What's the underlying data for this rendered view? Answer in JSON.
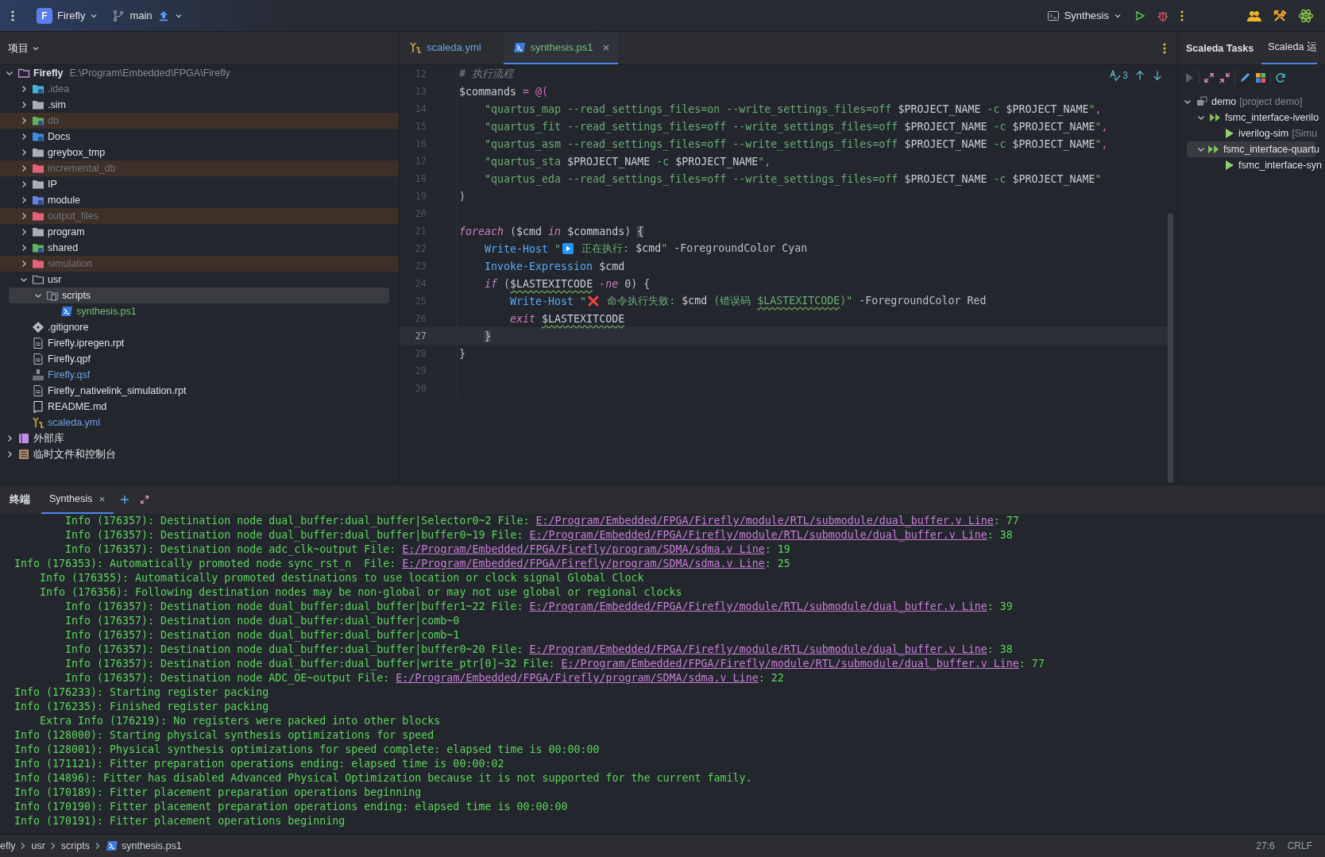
{
  "toolbar": {
    "project": {
      "letter": "F",
      "name": "Firefly"
    },
    "branch": "main",
    "run_config": "Synthesis"
  },
  "project_panel": {
    "title": "项目",
    "tree": [
      {
        "label": "Firefly",
        "path": "E:\\Program\\Embedded\\FPGA\\Firefly",
        "kind": "project_root",
        "excluded": false,
        "expanded": true,
        "selected": false,
        "children": [
          {
            "label": ".idea",
            "kind": "idea",
            "color": "#7a7e85",
            "excluded": false,
            "expanded": false,
            "selected": false
          },
          {
            "label": ".sim",
            "kind": "folder",
            "excluded": false,
            "expanded": false,
            "selected": false
          },
          {
            "label": "db",
            "kind": "db",
            "excluded": true,
            "expanded": false,
            "selected": false
          },
          {
            "label": "Docs",
            "kind": "docs",
            "excluded": false,
            "expanded": false,
            "selected": false
          },
          {
            "label": "greybox_tmp",
            "kind": "folder",
            "excluded": false,
            "expanded": false,
            "selected": false
          },
          {
            "label": "incremental_db",
            "kind": "excluded_folder",
            "excluded": true,
            "expanded": false,
            "selected": false
          },
          {
            "label": "IP",
            "kind": "folder",
            "excluded": false,
            "expanded": false,
            "selected": false
          },
          {
            "label": "module",
            "kind": "module",
            "excluded": false,
            "expanded": false,
            "selected": false
          },
          {
            "label": "output_files",
            "kind": "excluded_folder",
            "excluded": true,
            "expanded": false,
            "selected": false
          },
          {
            "label": "program",
            "kind": "folder",
            "excluded": false,
            "expanded": false,
            "selected": false
          },
          {
            "label": "shared",
            "kind": "shared",
            "excluded": false,
            "expanded": false,
            "selected": false
          },
          {
            "label": "simulation",
            "kind": "excluded_folder",
            "excluded": true,
            "expanded": false,
            "selected": false
          },
          {
            "label": "usr",
            "kind": "folder_open",
            "excluded": false,
            "expanded": true,
            "selected": false,
            "children": [
              {
                "label": "scripts",
                "kind": "scripts",
                "excluded": false,
                "expanded": true,
                "selected": true,
                "children": [
                  {
                    "label": "synthesis.ps1",
                    "kind": "ps1",
                    "color": "#73bd79",
                    "excluded": false,
                    "selected": false
                  }
                ]
              }
            ]
          },
          {
            "label": ".gitignore",
            "kind": "git",
            "excluded": false,
            "selected": false
          },
          {
            "label": "Firefly.ipregen.rpt",
            "kind": "text",
            "excluded": false,
            "selected": false
          },
          {
            "label": "Firefly.qpf",
            "kind": "text",
            "excluded": false,
            "selected": false
          },
          {
            "label": "Firefly.qsf",
            "kind": "tcl",
            "color": "#6ea0e6",
            "excluded": false,
            "selected": false
          },
          {
            "label": "Firefly_nativelink_simulation.rpt",
            "kind": "text",
            "excluded": false,
            "selected": false
          },
          {
            "label": "README.md",
            "kind": "readme",
            "excluded": false,
            "selected": false
          },
          {
            "label": "scaleda.yml",
            "kind": "yaml",
            "color": "#6ea0e6",
            "excluded": false,
            "selected": false
          }
        ]
      },
      {
        "label": "外部库",
        "kind": "library",
        "excluded": false,
        "expanded": false,
        "selected": false
      },
      {
        "label": "临时文件和控制台",
        "kind": "scratch",
        "excluded": false,
        "expanded": false,
        "selected": false
      }
    ]
  },
  "editor": {
    "tabs": [
      {
        "label": "scaleda.yml",
        "kind": "yaml",
        "color": "#6ea0e6",
        "selected": false,
        "closable": false
      },
      {
        "label": "synthesis.ps1",
        "kind": "ps1",
        "color": "#73bd79",
        "selected": true,
        "closable": true
      }
    ],
    "inspections": "3",
    "lines": [
      {
        "number": "12",
        "current": false,
        "tokens": [
          {
            "kind": "comment",
            "text": "# 执行流程"
          }
        ]
      },
      {
        "number": "13",
        "current": false,
        "tokens": [
          {
            "kind": "var",
            "text": "$commands "
          },
          {
            "kind": "op",
            "text": "= @("
          }
        ]
      },
      {
        "number": "14",
        "current": false,
        "tokens": [
          {
            "kind": "string",
            "text": "    \"quartus_map --read_settings_files=on --write_settings_files=off "
          },
          {
            "kind": "var",
            "text": "$PROJECT_NAME"
          },
          {
            "kind": "string",
            "text": " -c "
          },
          {
            "kind": "var",
            "text": "$PROJECT_NAME"
          },
          {
            "kind": "string",
            "text": "\""
          },
          {
            "kind": "op",
            "text": ","
          }
        ]
      },
      {
        "number": "15",
        "current": false,
        "tokens": [
          {
            "kind": "string",
            "text": "    \"quartus_fit --read_settings_files=off --write_settings_files=off "
          },
          {
            "kind": "var",
            "text": "$PROJECT_NAME"
          },
          {
            "kind": "string",
            "text": " -c "
          },
          {
            "kind": "var",
            "text": "$PROJECT_NAME"
          },
          {
            "kind": "string",
            "text": "\""
          },
          {
            "kind": "op",
            "text": ","
          }
        ]
      },
      {
        "number": "16",
        "current": false,
        "tokens": [
          {
            "kind": "string",
            "text": "    \"quartus_asm --read_settings_files=off --write_settings_files=off "
          },
          {
            "kind": "var",
            "text": "$PROJECT_NAME"
          },
          {
            "kind": "string",
            "text": " -c "
          },
          {
            "kind": "var",
            "text": "$PROJECT_NAME"
          },
          {
            "kind": "string",
            "text": "\""
          },
          {
            "kind": "op",
            "text": ","
          }
        ]
      },
      {
        "number": "17",
        "current": false,
        "tokens": [
          {
            "kind": "string",
            "text": "    \"quartus_sta "
          },
          {
            "kind": "var",
            "text": "$PROJECT_NAME"
          },
          {
            "kind": "string",
            "text": " -c "
          },
          {
            "kind": "var",
            "text": "$PROJECT_NAME"
          },
          {
            "kind": "string",
            "text": "\""
          },
          {
            "kind": "op",
            "text": ","
          }
        ]
      },
      {
        "number": "18",
        "current": false,
        "tokens": [
          {
            "kind": "string",
            "text": "    \"quartus_eda --read_settings_files=off --write_settings_files=off "
          },
          {
            "kind": "var",
            "text": "$PROJECT_NAME"
          },
          {
            "kind": "string",
            "text": " -c "
          },
          {
            "kind": "var",
            "text": "$PROJECT_NAME"
          },
          {
            "kind": "string",
            "text": "\""
          }
        ]
      },
      {
        "number": "19",
        "current": false,
        "tokens": [
          {
            "kind": "plain",
            "text": ")"
          }
        ]
      },
      {
        "number": "20",
        "current": false
      },
      {
        "number": "21",
        "current": false,
        "tokens": [
          {
            "kind": "keyword",
            "text": "foreach"
          },
          {
            "kind": "plain",
            "text": " ("
          },
          {
            "kind": "var",
            "text": "$cmd "
          },
          {
            "kind": "keyword",
            "text": "in "
          },
          {
            "kind": "var",
            "text": "$commands"
          },
          {
            "kind": "plain",
            "text": ") {",
            "matched": true
          }
        ]
      },
      {
        "number": "22",
        "current": false,
        "tokens": [
          {
            "kind": "cmdlet",
            "text": "    Write-Host"
          },
          {
            "kind": "string",
            "text": " \""
          },
          {
            "kind": "play_glyph"
          },
          {
            "kind": "string",
            "text": " 正在执行: "
          },
          {
            "kind": "var",
            "text": "$cmd"
          },
          {
            "kind": "string",
            "text": "\""
          },
          {
            "kind": "plain",
            "text": " -ForegroundColor Cyan"
          }
        ]
      },
      {
        "number": "23",
        "current": false,
        "tokens": [
          {
            "kind": "cmdlet",
            "text": "    Invoke-Expression"
          },
          {
            "kind": "var",
            "text": " $cmd"
          }
        ]
      },
      {
        "number": "24",
        "current": false,
        "tokens": [
          {
            "kind": "keyword",
            "text": "    if"
          },
          {
            "kind": "plain",
            "text": " ("
          },
          {
            "kind": "var",
            "text": "$LASTEXITCODE",
            "warning": true
          },
          {
            "kind": "keyword",
            "text": " -ne"
          },
          {
            "kind": "plain",
            "text": " 0) {"
          }
        ]
      },
      {
        "number": "25",
        "current": false,
        "tokens": [
          {
            "kind": "cmdlet",
            "text": "        Write-Host"
          },
          {
            "kind": "string",
            "text": " \""
          },
          {
            "kind": "cross_glyph"
          },
          {
            "kind": "string",
            "text": " 命令执行失败: "
          },
          {
            "kind": "var",
            "text": "$cmd"
          },
          {
            "kind": "string",
            "text": " (错误码 "
          },
          {
            "kind": "string",
            "text": "$LASTEXITCODE",
            "warning": true
          },
          {
            "kind": "string",
            "text": ")\""
          },
          {
            "kind": "plain",
            "text": " -ForegroundColor Red"
          }
        ]
      },
      {
        "number": "26",
        "current": false,
        "tokens": [
          {
            "kind": "keyword",
            "text": "        exit "
          },
          {
            "kind": "var",
            "text": "$LASTEXITCODE",
            "warning": true
          }
        ]
      },
      {
        "number": "27",
        "current": true,
        "tokens": [
          {
            "kind": "plain",
            "text": "    }",
            "matched": true
          }
        ]
      },
      {
        "number": "28",
        "current": false,
        "tokens": [
          {
            "kind": "plain",
            "text": "}"
          }
        ]
      },
      {
        "number": "29",
        "current": false
      },
      {
        "number": "30",
        "current": false
      }
    ]
  },
  "tasks_panel": {
    "title": "Scaleda Tasks",
    "tabs": [
      {
        "label": "Scaleda 运",
        "selected": true
      }
    ],
    "tree": [
      {
        "label": "demo",
        "note": "[project demo]",
        "kind": "project",
        "expanded": true,
        "selected": false,
        "children": [
          {
            "label": "fsmc_interface-iverilo",
            "kind": "group",
            "expanded": true,
            "selected": false,
            "children": [
              {
                "label": "iverilog-sim",
                "note": "[Simu",
                "kind": "task",
                "selected": false
              }
            ]
          },
          {
            "label": "fsmc_interface-quartu",
            "kind": "group",
            "expanded": true,
            "selected": true,
            "children": [
              {
                "label": "fsmc_interface-syn",
                "kind": "task",
                "selected": false
              }
            ]
          }
        ]
      }
    ]
  },
  "terminal": {
    "title": "终端",
    "tabs": [
      {
        "label": "Synthesis",
        "selected": true,
        "closable": true
      }
    ],
    "lines": [
      {
        "text": "        Info (176357): Destination node dual_buffer:dual_buffer|Selector0~2 File: ",
        "link": "E:/Program/Embedded/FPGA/Firefly/module/RTL/submodule/dual_buffer.v Line",
        "after": ": 77"
      },
      {
        "text": "        Info (176357): Destination node dual_buffer:dual_buffer|buffer0~19 File: ",
        "link": "E:/Program/Embedded/FPGA/Firefly/module/RTL/submodule/dual_buffer.v Line",
        "after": ": 38"
      },
      {
        "text": "        Info (176357): Destination node adc_clk~output File: ",
        "link": "E:/Program/Embedded/FPGA/Firefly/program/SDMA/sdma.v Line",
        "after": ": 19"
      },
      {
        "text": "Info (176353): Automatically promoted node sync_rst_n  File: ",
        "link": "E:/Program/Embedded/FPGA/Firefly/program/SDMA/sdma.v Line",
        "after": ": 25"
      },
      {
        "text": "    Info (176355): Automatically promoted destinations to use location or clock signal Global Clock"
      },
      {
        "text": "    Info (176356): Following destination nodes may be non-global or may not use global or regional clocks"
      },
      {
        "text": "        Info (176357): Destination node dual_buffer:dual_buffer|buffer1~22 File: ",
        "link": "E:/Program/Embedded/FPGA/Firefly/module/RTL/submodule/dual_buffer.v Line",
        "after": ": 39"
      },
      {
        "text": "        Info (176357): Destination node dual_buffer:dual_buffer|comb~0"
      },
      {
        "text": "        Info (176357): Destination node dual_buffer:dual_buffer|comb~1"
      },
      {
        "text": "        Info (176357): Destination node dual_buffer:dual_buffer|buffer0~20 File: ",
        "link": "E:/Program/Embedded/FPGA/Firefly/module/RTL/submodule/dual_buffer.v Line",
        "after": ": 38"
      },
      {
        "text": "        Info (176357): Destination node dual_buffer:dual_buffer|write_ptr[0]~32 File: ",
        "link": "E:/Program/Embedded/FPGA/Firefly/module/RTL/submodule/dual_buffer.v Line",
        "after": ": 77"
      },
      {
        "text": "        Info (176357): Destination node ADC_OE~output File: ",
        "link": "E:/Program/Embedded/FPGA/Firefly/program/SDMA/sdma.v Line",
        "after": ": 22"
      },
      {
        "text": "Info (176233): Starting register packing"
      },
      {
        "text": "Info (176235): Finished register packing"
      },
      {
        "text": "    Extra Info (176219): No registers were packed into other blocks"
      },
      {
        "text": "Info (128000): Starting physical synthesis optimizations for speed"
      },
      {
        "text": "Info (128001): Physical synthesis optimizations for speed complete: elapsed time is 00:00:00"
      },
      {
        "text": "Info (171121): Fitter preparation operations ending: elapsed time is 00:00:02"
      },
      {
        "text": "Info (14896): Fitter has disabled Advanced Physical Optimization because it is not supported for the current family."
      },
      {
        "text": "Info (170189): Fitter placement preparation operations beginning"
      },
      {
        "text": "Info (170190): Fitter placement preparation operations ending: elapsed time is 00:00:00"
      },
      {
        "text": "Info (170191): Fitter placement operations beginning"
      }
    ]
  },
  "status_bar": {
    "breadcrumbs": [
      {
        "label": "efly"
      },
      {
        "label": "usr"
      },
      {
        "label": "scripts"
      },
      {
        "label": "synthesis.ps1",
        "kind": "ps1"
      }
    ],
    "position": "27:6",
    "line_ending": "CRLF"
  }
}
